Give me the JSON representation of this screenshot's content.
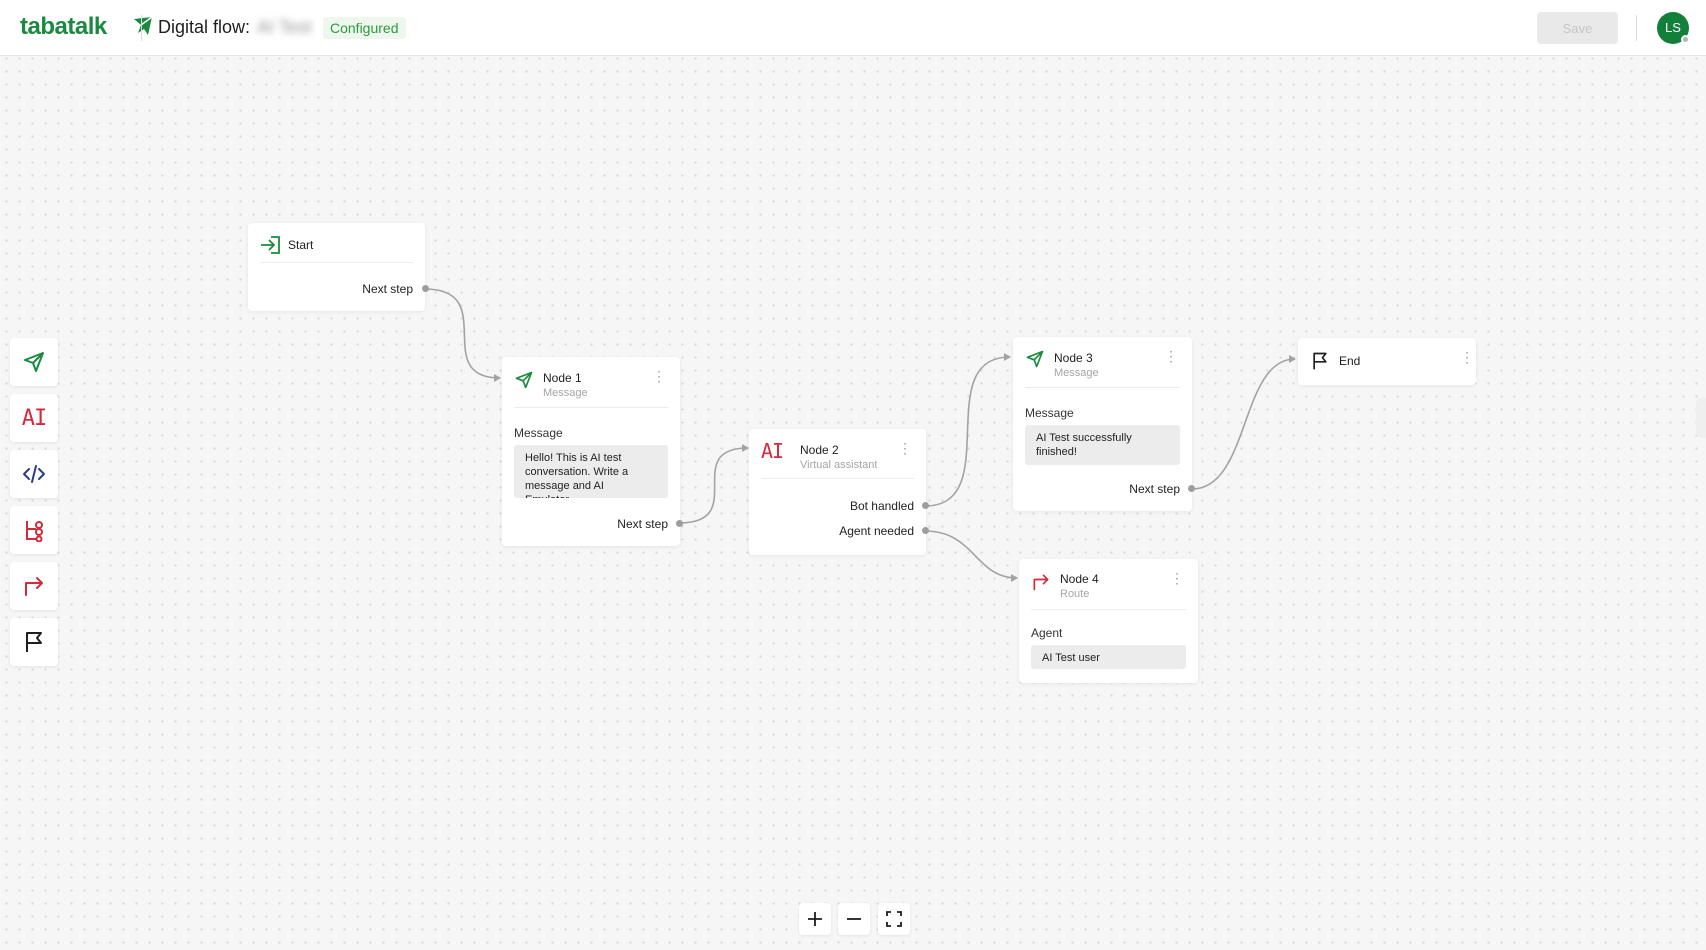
{
  "header": {
    "logo_text": "tabatalk",
    "flow_title": "Digital flow:",
    "flow_name": "AI Test",
    "status_badge": "Configured",
    "save_label": "Save",
    "avatar_initials": "LS"
  },
  "toolbox": {
    "items": [
      {
        "icon": "send-message-icon",
        "color": "#1a8a3e"
      },
      {
        "icon": "ai-icon",
        "label": "AI",
        "color": "#d42a3a"
      },
      {
        "icon": "code-icon",
        "color": "#2a3a8c"
      },
      {
        "icon": "branch-icon",
        "color": "#d42a3a"
      },
      {
        "icon": "route-icon",
        "color": "#d42a3a"
      },
      {
        "icon": "end-flag-icon",
        "color": "#1e1e1e"
      }
    ]
  },
  "nodes": {
    "start": {
      "title": "Start",
      "port": "Next step"
    },
    "node1": {
      "title": "Node 1",
      "type": "Message",
      "field_label": "Message",
      "field_value": "Hello! This is AI test conversation. Write a message and AI Emulator...",
      "port": "Next step"
    },
    "node2": {
      "title": "Node 2",
      "icon_label": "AI",
      "type": "Virtual assistant",
      "ports": [
        "Bot handled",
        "Agent needed"
      ]
    },
    "node3": {
      "title": "Node 3",
      "type": "Message",
      "field_label": "Message",
      "field_value": "AI Test successfully finished!",
      "port": "Next step"
    },
    "node4": {
      "title": "Node 4",
      "type": "Route",
      "field_label": "Agent",
      "field_value": "AI Test user"
    },
    "end": {
      "title": "End"
    }
  },
  "colors": {
    "brand_green": "#1a8a3e",
    "ai_red": "#d42a3a",
    "connector_gray": "#9d9d9d",
    "status_green": "#2e9b3e"
  },
  "zoom_controls": {
    "zoom_in": "zoom-in-icon",
    "zoom_out": "zoom-out-icon",
    "fit": "fit-screen-icon"
  }
}
